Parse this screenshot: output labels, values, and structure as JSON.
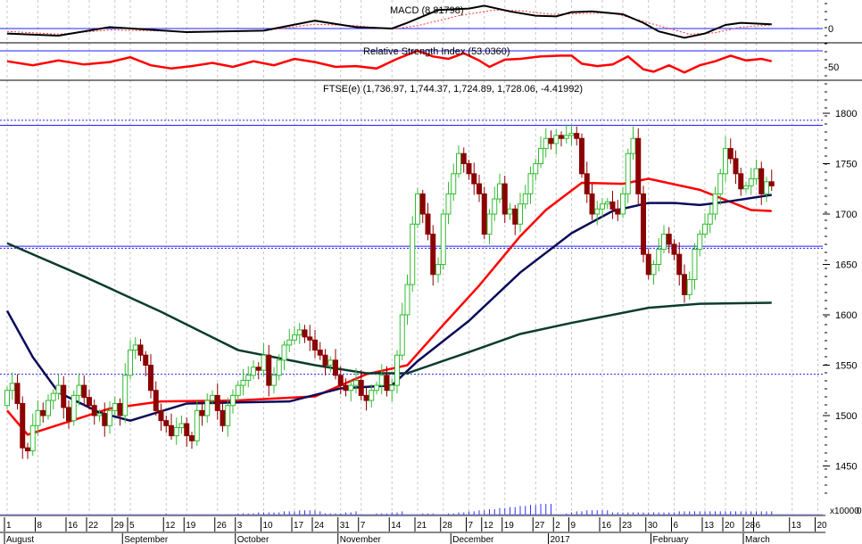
{
  "chart_data": {
    "type": "candlestick",
    "title": "FTSE(e) (1,736.97, 1,744.37, 1,724.89, 1,728.06, -4.41992)",
    "symbol": "FTSE(e)",
    "last_ohlc_label": "(1,736.97, 1,744.37, 1,724.89, 1,728.06, -4.41992)",
    "ylim": [
      1410,
      1830
    ],
    "yticks": [
      1450,
      1500,
      1550,
      1600,
      1650,
      1700,
      1750,
      1800
    ],
    "closes": [
      1525,
      1532,
      1512,
      1468,
      1465,
      1490,
      1505,
      1500,
      1515,
      1522,
      1530,
      1508,
      1495,
      1520,
      1530,
      1518,
      1510,
      1500,
      1502,
      1490,
      1505,
      1512,
      1500,
      1540,
      1565,
      1570,
      1560,
      1550,
      1525,
      1505,
      1495,
      1490,
      1480,
      1488,
      1492,
      1480,
      1475,
      1505,
      1500,
      1515,
      1520,
      1505,
      1490,
      1510,
      1520,
      1530,
      1535,
      1540,
      1548,
      1545,
      1560,
      1530,
      1540,
      1555,
      1570,
      1575,
      1580,
      1585,
      1578,
      1575,
      1565,
      1560,
      1550,
      1555,
      1540,
      1530,
      1525,
      1530,
      1535,
      1520,
      1515,
      1525,
      1530,
      1540,
      1525,
      1530,
      1560,
      1600,
      1630,
      1690,
      1720,
      1700,
      1680,
      1640,
      1650,
      1700,
      1720,
      1740,
      1760,
      1750,
      1740,
      1730,
      1720,
      1680,
      1700,
      1715,
      1730,
      1700,
      1705,
      1690,
      1710,
      1720,
      1740,
      1750,
      1765,
      1775,
      1770,
      1778,
      1775,
      1778,
      1780,
      1775,
      1740,
      1720,
      1700,
      1705,
      1710,
      1712,
      1705,
      1700,
      1720,
      1760,
      1775,
      1720,
      1660,
      1640,
      1650,
      1665,
      1680,
      1670,
      1660,
      1640,
      1620,
      1635,
      1665,
      1680,
      1690,
      1700,
      1720,
      1740,
      1765,
      1755,
      1740,
      1725,
      1728,
      1735,
      1745,
      1720,
      1732,
      1728
    ],
    "first_open": 1510,
    "moving_averages": [
      {
        "name": "short",
        "color": "#ff0000",
        "points": [
          [
            0,
            1505
          ],
          [
            4,
            1481
          ],
          [
            20,
            1507
          ],
          [
            30,
            1514
          ],
          [
            45,
            1515
          ],
          [
            60,
            1519
          ],
          [
            70,
            1541
          ],
          [
            78,
            1550
          ],
          [
            85,
            1590
          ],
          [
            92,
            1629
          ],
          [
            100,
            1678
          ],
          [
            105,
            1704
          ],
          [
            112,
            1731
          ],
          [
            120,
            1730
          ],
          [
            125,
            1735
          ],
          [
            135,
            1724
          ],
          [
            145,
            1704
          ],
          [
            149,
            1703
          ]
        ]
      },
      {
        "name": "medium",
        "color": "#0a0a5a",
        "points": [
          [
            0,
            1604
          ],
          [
            5,
            1558
          ],
          [
            10,
            1523
          ],
          [
            18,
            1503
          ],
          [
            24,
            1495
          ],
          [
            35,
            1512
          ],
          [
            55,
            1514
          ],
          [
            65,
            1527
          ],
          [
            75,
            1530
          ],
          [
            80,
            1554
          ],
          [
            90,
            1594
          ],
          [
            100,
            1642
          ],
          [
            110,
            1681
          ],
          [
            118,
            1703
          ],
          [
            125,
            1711
          ],
          [
            130,
            1711
          ],
          [
            135,
            1709
          ],
          [
            140,
            1712
          ],
          [
            149,
            1719
          ]
        ]
      },
      {
        "name": "long",
        "color": "#0c3b2e",
        "points": [
          [
            0,
            1671
          ],
          [
            15,
            1638
          ],
          [
            30,
            1603
          ],
          [
            45,
            1565
          ],
          [
            60,
            1550
          ],
          [
            70,
            1542
          ],
          [
            78,
            1542
          ],
          [
            90,
            1563
          ],
          [
            100,
            1581
          ],
          [
            110,
            1592
          ],
          [
            125,
            1607
          ],
          [
            135,
            1611
          ],
          [
            149,
            1612
          ]
        ]
      }
    ],
    "horizontal_lines": [
      {
        "value": 1793,
        "style": "dotted"
      },
      {
        "value": 1788,
        "style": "solid"
      },
      {
        "value": 1668,
        "style": "solid"
      },
      {
        "value": 1666,
        "style": "dotted"
      },
      {
        "value": 1541,
        "style": "dotted"
      }
    ],
    "volume": {
      "unit_label": "x10000",
      "axis_label": "0",
      "values": [
        0,
        0,
        0,
        0,
        0,
        0,
        0,
        0,
        0,
        0,
        0,
        0,
        0,
        0,
        0,
        0,
        0,
        0,
        0,
        0,
        0,
        0,
        0,
        0,
        0,
        0,
        0,
        0,
        0,
        0,
        0,
        1,
        0,
        0,
        0,
        0,
        0,
        0,
        0,
        0,
        0,
        0,
        0,
        0,
        0,
        1,
        1,
        1,
        1,
        2,
        2,
        2,
        2,
        2,
        3,
        3,
        3,
        4,
        4,
        4,
        4,
        3,
        1,
        1,
        1,
        1,
        2,
        2,
        3,
        0,
        0,
        0,
        1,
        1,
        1,
        2,
        2,
        3,
        0,
        0,
        0,
        1,
        1,
        1,
        0,
        0,
        1,
        1,
        2,
        2,
        3,
        3,
        4,
        4,
        5,
        5,
        6,
        6,
        7,
        7,
        8,
        8,
        9,
        9,
        10,
        10,
        10,
        0,
        0,
        1,
        2,
        3,
        3,
        4,
        4,
        4,
        4,
        4,
        2,
        2,
        2,
        2,
        2,
        2,
        2,
        2,
        2,
        2,
        2,
        2,
        2,
        3,
        3,
        3,
        3,
        3,
        3,
        3,
        3,
        3,
        3,
        3,
        3,
        3,
        3,
        3,
        3,
        3,
        3,
        3
      ]
    },
    "x_day_ticks": [
      [
        0,
        "1"
      ],
      [
        6,
        "8"
      ],
      [
        12,
        "16"
      ],
      [
        16,
        "22"
      ],
      [
        21,
        "29"
      ],
      [
        24,
        "5"
      ],
      [
        31,
        "12"
      ],
      [
        35,
        "19"
      ],
      [
        41,
        "26"
      ],
      [
        45,
        "3"
      ],
      [
        50,
        "10"
      ],
      [
        56,
        "17"
      ],
      [
        60,
        "24"
      ],
      [
        65,
        "31"
      ],
      [
        69,
        "7"
      ],
      [
        75,
        "14"
      ],
      [
        80,
        "21"
      ],
      [
        85,
        "28"
      ],
      [
        90,
        "7"
      ],
      [
        93,
        "12"
      ],
      [
        97,
        "19"
      ],
      [
        103,
        "27"
      ],
      [
        107,
        "2"
      ],
      [
        110,
        "9"
      ],
      [
        116,
        "16"
      ],
      [
        120,
        "23"
      ],
      [
        125,
        "30"
      ],
      [
        130,
        "6"
      ],
      [
        136,
        "13"
      ],
      [
        140,
        "20"
      ],
      [
        144,
        "28"
      ],
      [
        146,
        "6"
      ],
      [
        153,
        "13"
      ],
      [
        158,
        "20"
      ]
    ],
    "x_month_ticks": [
      [
        0,
        "August"
      ],
      [
        23,
        "September"
      ],
      [
        45,
        "October"
      ],
      [
        65,
        "November"
      ],
      [
        87,
        "December"
      ],
      [
        106,
        "2017"
      ],
      [
        126,
        "February"
      ],
      [
        144,
        "March"
      ]
    ],
    "macd": {
      "label": "MACD (8.81798)",
      "axis_label": "0",
      "line": [
        [
          0,
          -7
        ],
        [
          10,
          -10
        ],
        [
          20,
          2
        ],
        [
          35,
          -5
        ],
        [
          50,
          -3
        ],
        [
          60,
          11
        ],
        [
          68,
          2
        ],
        [
          75,
          0
        ],
        [
          78,
          8
        ],
        [
          84,
          26
        ],
        [
          90,
          28
        ],
        [
          93,
          32
        ],
        [
          98,
          24
        ],
        [
          103,
          18
        ],
        [
          107,
          17
        ],
        [
          110,
          23
        ],
        [
          114,
          24
        ],
        [
          120,
          20
        ],
        [
          124,
          8
        ],
        [
          127,
          -4
        ],
        [
          132,
          -13
        ],
        [
          136,
          -7
        ],
        [
          140,
          5
        ],
        [
          143,
          8
        ],
        [
          149,
          6
        ]
      ],
      "signal": [
        [
          0,
          -4
        ],
        [
          10,
          -8
        ],
        [
          20,
          -2
        ],
        [
          35,
          -4
        ],
        [
          50,
          -3
        ],
        [
          60,
          6
        ],
        [
          68,
          4
        ],
        [
          75,
          -1
        ],
        [
          80,
          4
        ],
        [
          88,
          18
        ],
        [
          95,
          26
        ],
        [
          100,
          25
        ],
        [
          106,
          20
        ],
        [
          112,
          21
        ],
        [
          118,
          22
        ],
        [
          123,
          12
        ],
        [
          128,
          2
        ],
        [
          133,
          -8
        ],
        [
          138,
          -6
        ],
        [
          143,
          2
        ],
        [
          149,
          5
        ]
      ]
    },
    "rsi": {
      "label": "Relative Strength Index (53.0360)",
      "axis_label": "50",
      "reference_level": 70,
      "line": [
        [
          0,
          57
        ],
        [
          5,
          52
        ],
        [
          10,
          58
        ],
        [
          15,
          53
        ],
        [
          20,
          56
        ],
        [
          24,
          62
        ],
        [
          28,
          52
        ],
        [
          32,
          48
        ],
        [
          36,
          51
        ],
        [
          40,
          55
        ],
        [
          44,
          50
        ],
        [
          48,
          57
        ],
        [
          52,
          52
        ],
        [
          56,
          60
        ],
        [
          60,
          56
        ],
        [
          64,
          50
        ],
        [
          68,
          51
        ],
        [
          72,
          48
        ],
        [
          76,
          60
        ],
        [
          80,
          70
        ],
        [
          83,
          63
        ],
        [
          86,
          60
        ],
        [
          89,
          67
        ],
        [
          92,
          58
        ],
        [
          94,
          50
        ],
        [
          97,
          59
        ],
        [
          100,
          60
        ],
        [
          104,
          63
        ],
        [
          108,
          64
        ],
        [
          110,
          64
        ],
        [
          112,
          54
        ],
        [
          115,
          51
        ],
        [
          118,
          53
        ],
        [
          121,
          63
        ],
        [
          124,
          47
        ],
        [
          126,
          44
        ],
        [
          129,
          52
        ],
        [
          132,
          43
        ],
        [
          135,
          52
        ],
        [
          138,
          57
        ],
        [
          141,
          64
        ],
        [
          144,
          58
        ],
        [
          147,
          60
        ],
        [
          149,
          57
        ]
      ]
    }
  }
}
